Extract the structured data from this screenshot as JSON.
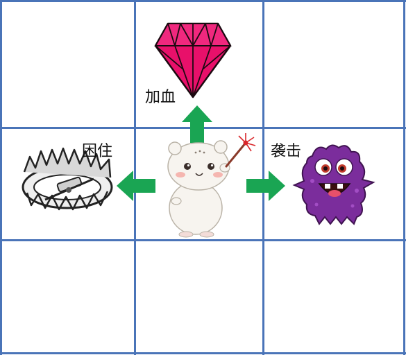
{
  "grid": {
    "rows": 3,
    "cols": 3,
    "line_color": "#4a74b8"
  },
  "center": {
    "character": "hamster",
    "holding": "magic-wand"
  },
  "actions": {
    "up": {
      "label": "加血",
      "target": "red-gem",
      "arrow_color": "#1aa553"
    },
    "left": {
      "label": "困住",
      "target": "bear-trap",
      "arrow_color": "#1aa553"
    },
    "right": {
      "label": "袭击",
      "target": "purple-monster",
      "arrow_color": "#1aa553"
    }
  },
  "colors": {
    "gem": "#e8106a",
    "monster": "#7b2d9c",
    "arrow": "#1aa553"
  }
}
